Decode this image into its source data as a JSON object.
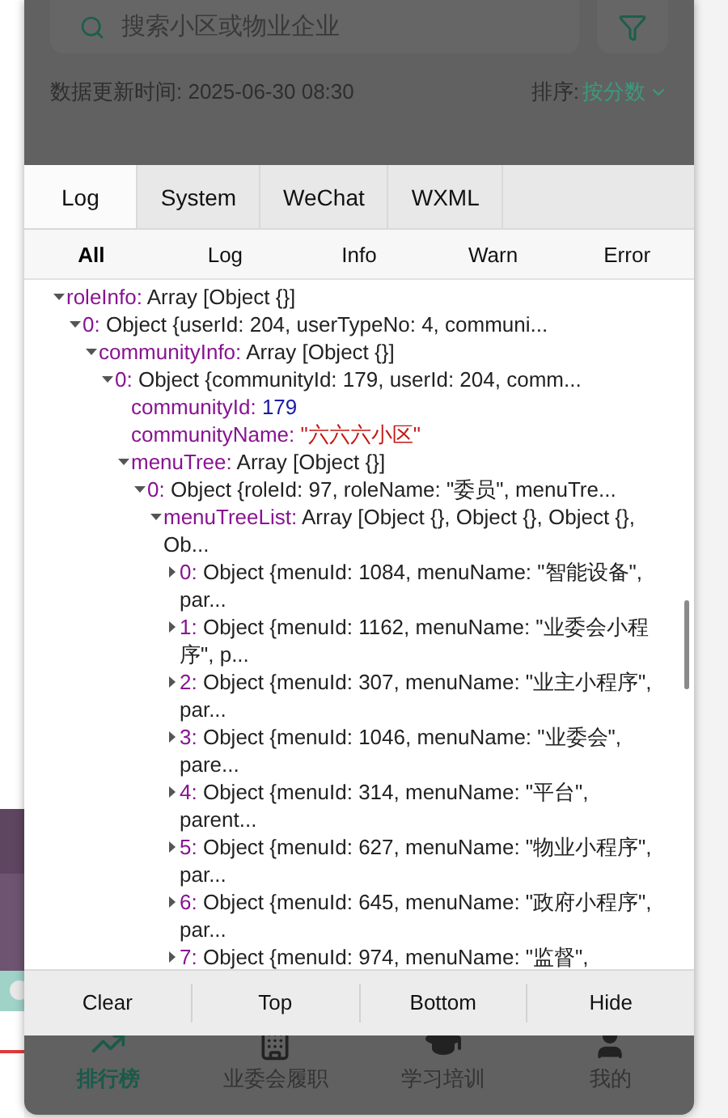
{
  "page": {
    "search_placeholder": "搜索小区或物业企业",
    "update_time": "数据更新时间: 2025-06-30 08:30",
    "sort_label": "排序:",
    "sort_value": "按分数"
  },
  "console": {
    "tabs": [
      {
        "label": "Log",
        "selected": true
      },
      {
        "label": "System",
        "selected": false
      },
      {
        "label": "WeChat",
        "selected": false
      },
      {
        "label": "WXML",
        "selected": false
      }
    ],
    "filters": [
      {
        "label": "All",
        "selected": true
      },
      {
        "label": "Log",
        "selected": false
      },
      {
        "label": "Info",
        "selected": false
      },
      {
        "label": "Warn",
        "selected": false
      },
      {
        "label": "Error",
        "selected": false
      }
    ],
    "tree": [
      {
        "key": "roleInfo:",
        "value": "Array [Object {}]",
        "kind": "object",
        "expanded": true,
        "children": [
          {
            "key": "0:",
            "value": "Object {userId: 204, userTypeNo: 4, communi...",
            "kind": "object",
            "expanded": true,
            "children": [
              {
                "key": "communityInfo:",
                "value": "Array [Object {}]",
                "kind": "object",
                "expanded": true,
                "children": [
                  {
                    "key": "0:",
                    "value": "Object {communityId: 179, userId: 204, comm...",
                    "kind": "object",
                    "expanded": true,
                    "children": [
                      {
                        "key": "communityId:",
                        "value": "179",
                        "kind": "number"
                      },
                      {
                        "key": "communityName:",
                        "value": "\"六六六小区\"",
                        "kind": "string"
                      },
                      {
                        "key": "menuTree:",
                        "value": "Array [Object {}]",
                        "kind": "object",
                        "expanded": true,
                        "children": [
                          {
                            "key": "0:",
                            "value": "Object {roleId: 97, roleName: \"委员\", menuTre...",
                            "kind": "object",
                            "expanded": true,
                            "children": [
                              {
                                "key": "menuTreeList:",
                                "value": "Array [Object {}, Object {}, Object {}, Ob...",
                                "kind": "object",
                                "expanded": true,
                                "children": [
                                  {
                                    "key": "0:",
                                    "value": "Object {menuId: 1084, menuName: \"智能设备\", par...",
                                    "kind": "object",
                                    "expanded": false
                                  },
                                  {
                                    "key": "1:",
                                    "value": "Object {menuId: 1162, menuName: \"业委会小程序\", p...",
                                    "kind": "object",
                                    "expanded": false
                                  },
                                  {
                                    "key": "2:",
                                    "value": "Object {menuId: 307, menuName: \"业主小程序\", par...",
                                    "kind": "object",
                                    "expanded": false
                                  },
                                  {
                                    "key": "3:",
                                    "value": "Object {menuId: 1046, menuName: \"业委会\", pare...",
                                    "kind": "object",
                                    "expanded": false
                                  },
                                  {
                                    "key": "4:",
                                    "value": "Object {menuId: 314, menuName: \"平台\", parent...",
                                    "kind": "object",
                                    "expanded": false
                                  },
                                  {
                                    "key": "5:",
                                    "value": "Object {menuId: 627, menuName: \"物业小程序\", par...",
                                    "kind": "object",
                                    "expanded": false
                                  },
                                  {
                                    "key": "6:",
                                    "value": "Object {menuId: 645, menuName: \"政府小程序\", par...",
                                    "kind": "object",
                                    "expanded": false
                                  },
                                  {
                                    "key": "7:",
                                    "value": "Object {menuId: 974, menuName: \"监督\",",
                                    "kind": "object",
                                    "expanded": false
                                  }
                                ]
                              }
                            ]
                          }
                        ]
                      }
                    ]
                  }
                ]
              }
            ]
          }
        ]
      }
    ],
    "footer_buttons": [
      "Clear",
      "Top",
      "Bottom",
      "Hide"
    ]
  },
  "bottom_nav": [
    {
      "label": "排行榜",
      "kind": "chart",
      "selected": true
    },
    {
      "label": "业委会履职",
      "kind": "building",
      "selected": false
    },
    {
      "label": "学习培训",
      "kind": "cap",
      "selected": false
    },
    {
      "label": "我的",
      "kind": "user",
      "selected": false
    }
  ]
}
